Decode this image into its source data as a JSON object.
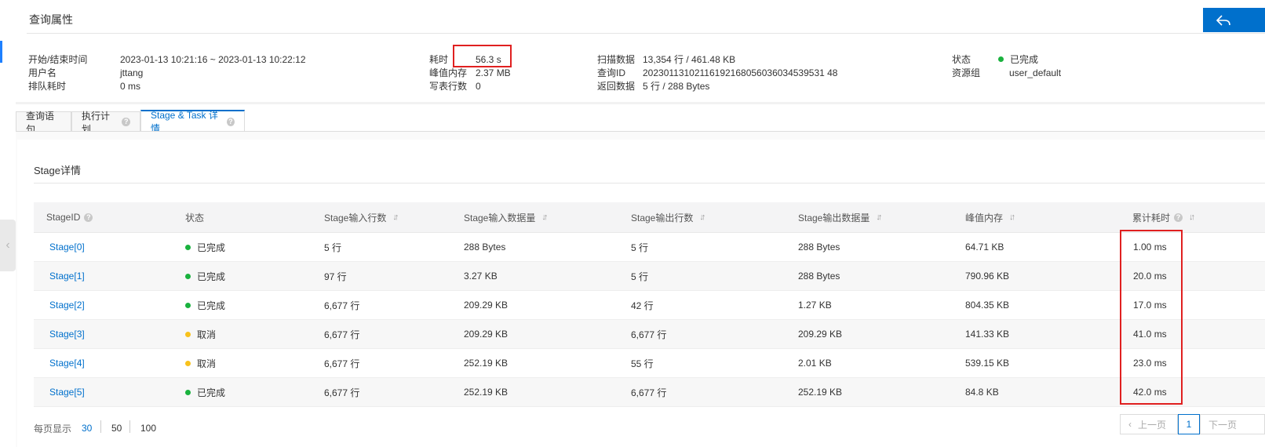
{
  "header": {
    "title": "查询属性",
    "back_icon": "back-arrow-icon"
  },
  "info": {
    "start_end_label": "开始/结束时间",
    "start_end_value": "2023-01-13 10:21:16 ~ 2023-01-13 10:22:12",
    "user_label": "用户名",
    "user_value": "jttang",
    "queue_label": "排队耗时",
    "queue_value": "0 ms",
    "elapsed_label": "耗时",
    "elapsed_value": "56.3 s",
    "peak_mem_label": "峰值内存",
    "peak_mem_value": "2.37 MB",
    "written_label": "写表行数",
    "written_value": "0",
    "scan_label": "扫描数据",
    "scan_value": "13,354 行 / 461.48 KB",
    "query_id_label": "查询ID",
    "query_id_value": "20230113102116192168056036034539531 48",
    "return_label": "返回数据",
    "return_value": "5 行 / 288 Bytes",
    "status_label": "状态",
    "status_value": "已完成",
    "resource_label": "资源组",
    "resource_value": "user_default"
  },
  "tabs": [
    {
      "label": "查询语句"
    },
    {
      "label": "执行计划"
    },
    {
      "label": "Stage & Task 详情"
    }
  ],
  "section": {
    "title": "Stage详情"
  },
  "table": {
    "headers": [
      "StageID",
      "状态",
      "Stage输入行数",
      "Stage输入数据量",
      "Stage输出行数",
      "Stage输出数据量",
      "峰值内存",
      "累计耗时"
    ],
    "rows": [
      {
        "id": "Stage[0]",
        "status": "已完成",
        "status_color": "#1ab23e",
        "in_rows": "5 行",
        "in_size": "288 Bytes",
        "out_rows": "5 行",
        "out_size": "288 Bytes",
        "peak": "64.71 KB",
        "time": "1.00 ms"
      },
      {
        "id": "Stage[1]",
        "status": "已完成",
        "status_color": "#1ab23e",
        "in_rows": "97 行",
        "in_size": "3.27 KB",
        "out_rows": "5 行",
        "out_size": "288 Bytes",
        "peak": "790.96 KB",
        "time": "20.0 ms"
      },
      {
        "id": "Stage[2]",
        "status": "已完成",
        "status_color": "#1ab23e",
        "in_rows": "6,677 行",
        "in_size": "209.29 KB",
        "out_rows": "42 行",
        "out_size": "1.27 KB",
        "peak": "804.35 KB",
        "time": "17.0 ms"
      },
      {
        "id": "Stage[3]",
        "status": "取消",
        "status_color": "#f8c21c",
        "in_rows": "6,677 行",
        "in_size": "209.29 KB",
        "out_rows": "6,677 行",
        "out_size": "209.29 KB",
        "peak": "141.33 KB",
        "time": "41.0 ms"
      },
      {
        "id": "Stage[4]",
        "status": "取消",
        "status_color": "#f8c21c",
        "in_rows": "6,677 行",
        "in_size": "252.19 KB",
        "out_rows": "55 行",
        "out_size": "2.01 KB",
        "peak": "539.15 KB",
        "time": "23.0 ms"
      },
      {
        "id": "Stage[5]",
        "status": "已完成",
        "status_color": "#1ab23e",
        "in_rows": "6,677 行",
        "in_size": "252.19 KB",
        "out_rows": "6,677 行",
        "out_size": "252.19 KB",
        "peak": "84.8 KB",
        "time": "42.0 ms"
      }
    ]
  },
  "pagination": {
    "page_size_label": "每页显示",
    "sizes": [
      "30",
      "50",
      "100"
    ],
    "prev_label": "上一页",
    "current_page": "1",
    "next_label": "下一页"
  },
  "colors": {
    "accent": "#0070cc",
    "highlight": "#e02020",
    "done": "#1ab23e",
    "cancel": "#f8c21c"
  }
}
